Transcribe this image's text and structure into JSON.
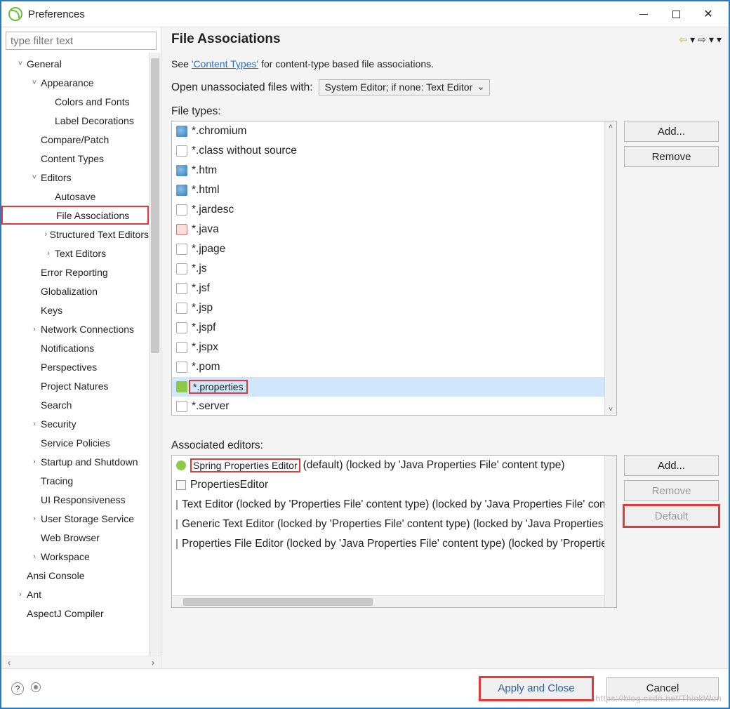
{
  "window": {
    "title": "Preferences"
  },
  "filter": {
    "placeholder": "type filter text"
  },
  "tree": [
    {
      "label": "General",
      "indent": 1,
      "tw": "˅"
    },
    {
      "label": "Appearance",
      "indent": 2,
      "tw": "˅"
    },
    {
      "label": "Colors and Fonts",
      "indent": 3,
      "tw": ""
    },
    {
      "label": "Label Decorations",
      "indent": 3,
      "tw": ""
    },
    {
      "label": "Compare/Patch",
      "indent": 2,
      "tw": ""
    },
    {
      "label": "Content Types",
      "indent": 2,
      "tw": ""
    },
    {
      "label": "Editors",
      "indent": 2,
      "tw": "˅"
    },
    {
      "label": "Autosave",
      "indent": 3,
      "tw": ""
    },
    {
      "label": "File Associations",
      "indent": 3,
      "tw": "",
      "selected": true
    },
    {
      "label": "Structured Text Editors",
      "indent": 3,
      "tw": "›"
    },
    {
      "label": "Text Editors",
      "indent": 3,
      "tw": "›"
    },
    {
      "label": "Error Reporting",
      "indent": 2,
      "tw": ""
    },
    {
      "label": "Globalization",
      "indent": 2,
      "tw": ""
    },
    {
      "label": "Keys",
      "indent": 2,
      "tw": ""
    },
    {
      "label": "Network Connections",
      "indent": 2,
      "tw": "›"
    },
    {
      "label": "Notifications",
      "indent": 2,
      "tw": ""
    },
    {
      "label": "Perspectives",
      "indent": 2,
      "tw": ""
    },
    {
      "label": "Project Natures",
      "indent": 2,
      "tw": ""
    },
    {
      "label": "Search",
      "indent": 2,
      "tw": ""
    },
    {
      "label": "Security",
      "indent": 2,
      "tw": "›"
    },
    {
      "label": "Service Policies",
      "indent": 2,
      "tw": ""
    },
    {
      "label": "Startup and Shutdown",
      "indent": 2,
      "tw": "›"
    },
    {
      "label": "Tracing",
      "indent": 2,
      "tw": ""
    },
    {
      "label": "UI Responsiveness",
      "indent": 2,
      "tw": ""
    },
    {
      "label": "User Storage Service",
      "indent": 2,
      "tw": "›"
    },
    {
      "label": "Web Browser",
      "indent": 2,
      "tw": ""
    },
    {
      "label": "Workspace",
      "indent": 2,
      "tw": "›"
    },
    {
      "label": "Ansi Console",
      "indent": 1,
      "tw": ""
    },
    {
      "label": "Ant",
      "indent": 1,
      "tw": "›"
    },
    {
      "label": "AspectJ Compiler",
      "indent": 1,
      "tw": ""
    }
  ],
  "page": {
    "title": "File Associations",
    "desc_pre": "See ",
    "desc_link": "'Content Types'",
    "desc_post": " for content-type based file associations.",
    "open_label": "Open unassociated files with:",
    "open_value": "System Editor; if none: Text Editor",
    "file_types_label": "File types:",
    "assoc_label": "Associated editors:"
  },
  "file_types": [
    {
      "label": "*.chromium",
      "icon": "ico-globe"
    },
    {
      "label": "*.class without source",
      "icon": "ico-doc"
    },
    {
      "label": "*.htm",
      "icon": "ico-globe"
    },
    {
      "label": "*.html",
      "icon": "ico-globe"
    },
    {
      "label": "*.jardesc",
      "icon": "ico-doc"
    },
    {
      "label": "*.java",
      "icon": "ico-java"
    },
    {
      "label": "*.jpage",
      "icon": "ico-doc"
    },
    {
      "label": "*.js",
      "icon": "ico-doc"
    },
    {
      "label": "*.jsf",
      "icon": "ico-doc"
    },
    {
      "label": "*.jsp",
      "icon": "ico-doc"
    },
    {
      "label": "*.jspf",
      "icon": "ico-doc"
    },
    {
      "label": "*.jspx",
      "icon": "ico-doc"
    },
    {
      "label": "*.pom",
      "icon": "ico-doc"
    },
    {
      "label": "*.properties",
      "icon": "ico-spring",
      "selected": true,
      "hl": true
    },
    {
      "label": "*.server",
      "icon": "ico-doc"
    }
  ],
  "ft_buttons": {
    "add": "Add...",
    "remove": "Remove"
  },
  "editors": [
    {
      "name": "Spring Properties Editor",
      "rest": " (default) (locked by 'Java Properties File' content type)",
      "icon": "ico-spring",
      "hl": true
    },
    {
      "name": "PropertiesEditor",
      "rest": "",
      "icon": "ico-txt"
    },
    {
      "name": "Text Editor (locked by 'Properties File' content type) (locked by 'Java Properties File' content type)",
      "rest": "",
      "icon": "ico-txt"
    },
    {
      "name": "Generic Text Editor (locked by 'Properties File' content type) (locked by 'Java Properties File' content type)",
      "rest": "",
      "icon": "ico-txt"
    },
    {
      "name": "Properties File Editor (locked by 'Java Properties File' content type) (locked by 'Properties File' content type)",
      "rest": "",
      "icon": "ico-txt"
    }
  ],
  "ed_buttons": {
    "add": "Add...",
    "remove": "Remove",
    "default": "Default"
  },
  "footer": {
    "apply": "Apply and Close",
    "cancel": "Cancel"
  },
  "watermark": "https://blog.csdn.net/ThinkWon"
}
